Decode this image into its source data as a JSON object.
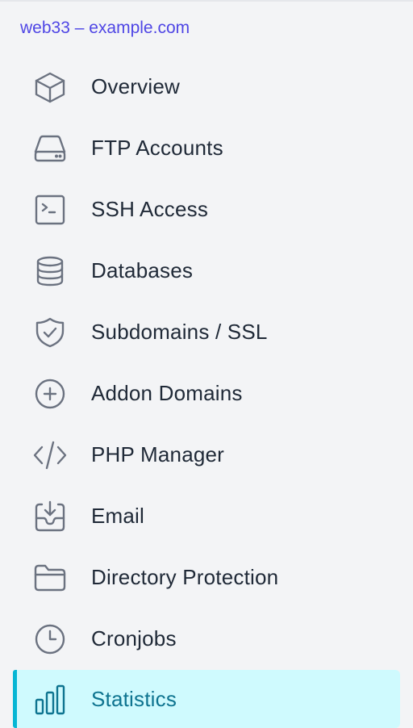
{
  "site": {
    "title": "web33 – example.com"
  },
  "nav": {
    "items": [
      {
        "label": "Overview",
        "icon": "cube-icon",
        "active": false
      },
      {
        "label": "FTP Accounts",
        "icon": "hard-drive-icon",
        "active": false
      },
      {
        "label": "SSH Access",
        "icon": "terminal-icon",
        "active": false
      },
      {
        "label": "Databases",
        "icon": "database-icon",
        "active": false
      },
      {
        "label": "Subdomains / SSL",
        "icon": "shield-check-icon",
        "active": false
      },
      {
        "label": "Addon Domains",
        "icon": "plus-circle-icon",
        "active": false
      },
      {
        "label": "PHP Manager",
        "icon": "code-icon",
        "active": false
      },
      {
        "label": "Email",
        "icon": "inbox-download-icon",
        "active": false
      },
      {
        "label": "Directory Protection",
        "icon": "folder-icon",
        "active": false
      },
      {
        "label": "Cronjobs",
        "icon": "clock-icon",
        "active": false
      },
      {
        "label": "Statistics",
        "icon": "bar-chart-icon",
        "active": true
      }
    ]
  },
  "colors": {
    "background": "#f3f4f6",
    "title": "#4f46e5",
    "text": "#1f2937",
    "icon": "#6b7280",
    "active_background": "#cffafe",
    "active_accent": "#06b6d4",
    "active_text": "#0e7490"
  }
}
